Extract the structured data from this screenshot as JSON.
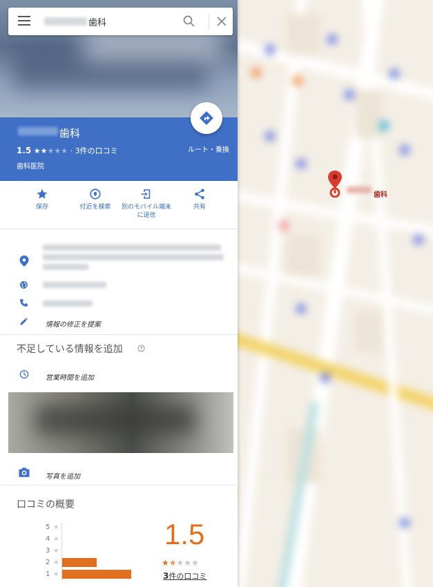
{
  "search": {
    "query": "歯科"
  },
  "place": {
    "name": "歯科",
    "rating": "1.5",
    "rating_stars": "★★★★★",
    "review_suffix": "· 3件の口コミ",
    "category": "歯科医院",
    "route_label": "ルート・乗換"
  },
  "actions": [
    {
      "label": "保存"
    },
    {
      "label": "付近を検索"
    },
    {
      "label": "別のモバイル端末に送信"
    },
    {
      "label": "共有"
    }
  ],
  "details": {
    "suggest_edit": "情報の修正を提案",
    "missing_title": "不足している情報を追加",
    "add_hours": "営業時間を追加",
    "add_photo": "写真を追加"
  },
  "reviews": {
    "title": "口コミの概要",
    "big_rating": "1.5",
    "stars_filled": "★",
    "stars_half": "★",
    "stars_empty": "★★★",
    "count_number": "3",
    "count_suffix": "件の口コミ",
    "histogram": [
      {
        "stars": "5",
        "fraction": 0.0
      },
      {
        "stars": "4",
        "fraction": 0.0
      },
      {
        "stars": "3",
        "fraction": 0.0
      },
      {
        "stars": "2",
        "fraction": 0.5
      },
      {
        "stars": "1",
        "fraction": 1.0
      }
    ]
  },
  "map": {
    "pin_label": "歯科"
  },
  "colors": {
    "header_blue": "#3f70c6",
    "accent_orange": "#e07020",
    "link_blue": "#3a6fc4",
    "pin_red": "#d93b30"
  }
}
